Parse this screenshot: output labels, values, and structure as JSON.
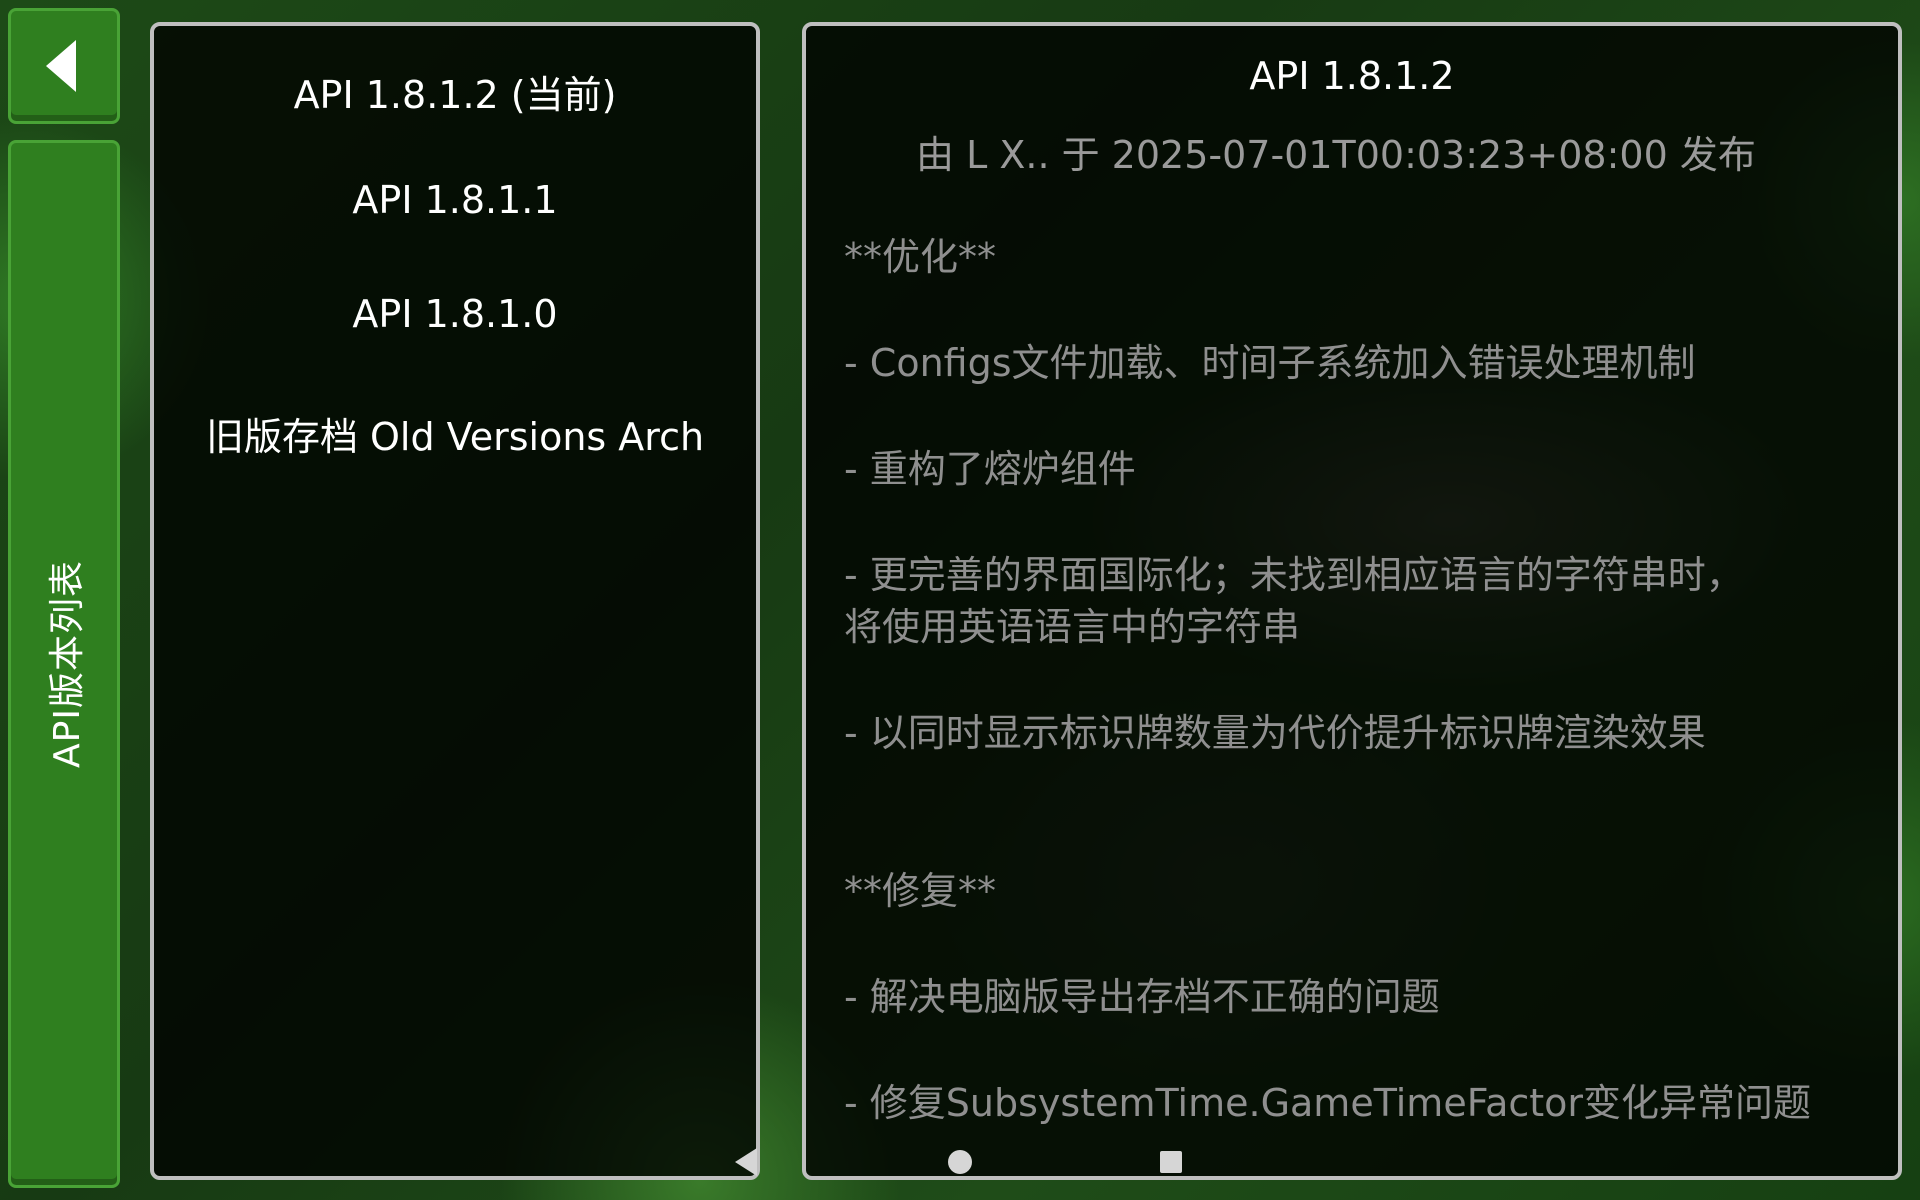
{
  "sidebar": {
    "back_icon": "back-arrow-icon",
    "tab_label": "API版本列表"
  },
  "versions": [
    "API 1.8.1.2 (当前)",
    "API 1.8.1.1",
    "API 1.8.1.0",
    "旧版存档 Old Versions Arch"
  ],
  "detail": {
    "title": "API 1.8.1.2",
    "author_line": "由 L X.. 于 2025-07-01T00:03:23+08:00 发布",
    "lines": [
      "**优化**",
      "- Configs文件加载、时间子系统加入错误处理机制",
      "- 重构了熔炉组件",
      "- 更完善的界面国际化；未找到相应语言的字符串时，",
      "将使用英语语言中的字符串",
      "- 以同时显示标识牌数量为代价提升标识牌渲染效果",
      "**修复**",
      "- 解决电脑版导出存档不正确的问题",
      "- 修复SubsystemTime.GameTimeFactor变化异常问题"
    ]
  },
  "navbar": {
    "back_icon": "nav-back-icon",
    "home_icon": "nav-home-icon",
    "recent_icon": "nav-recent-icon"
  },
  "colors": {
    "tab_green": "#2f7f1f",
    "tab_border": "#49a336",
    "panel_border": "#bfbfbf",
    "body_text": "#8f8f8f"
  }
}
